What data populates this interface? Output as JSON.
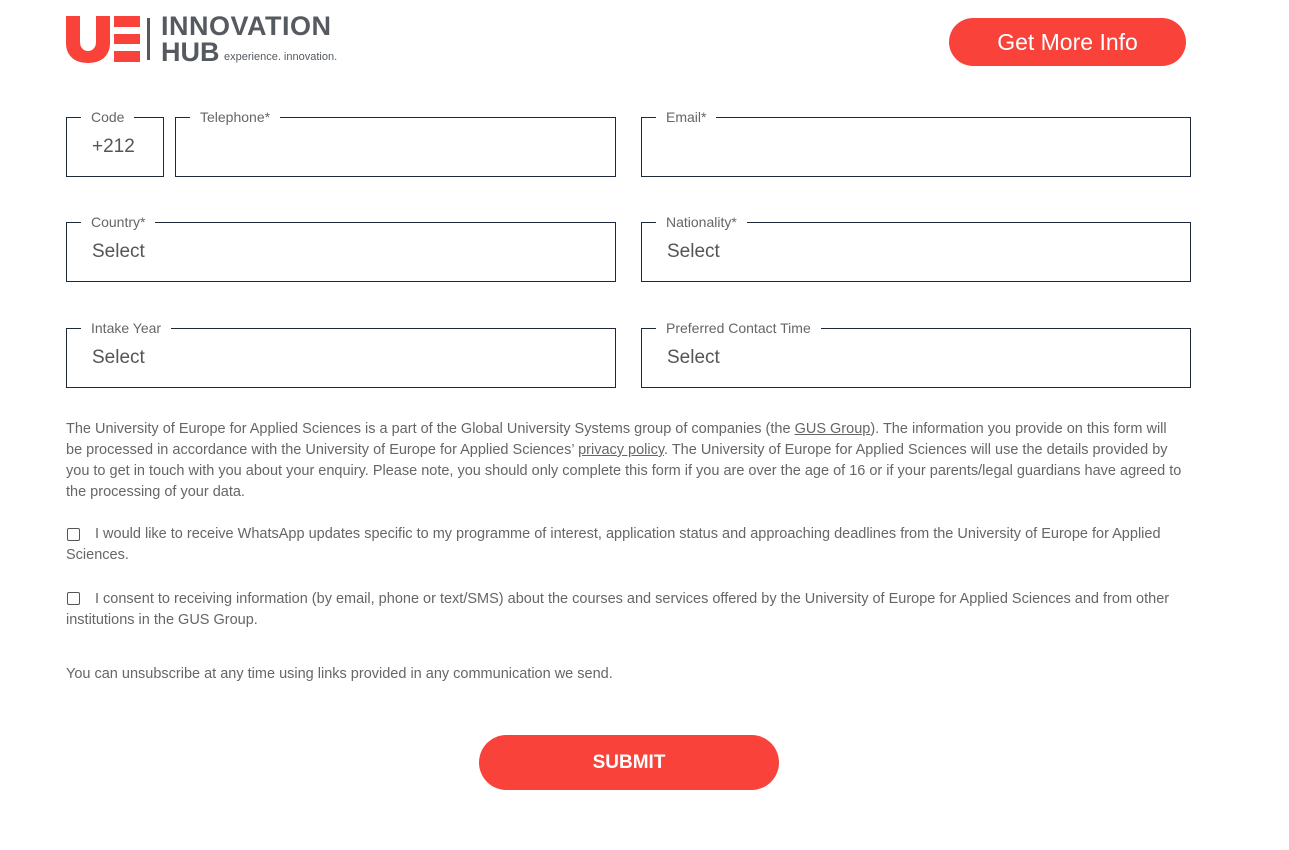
{
  "header": {
    "logo_line1": "INNOVATION",
    "logo_line2": "HUB",
    "logo_tagline": "experience. innovation.",
    "cta_label": "Get More Info"
  },
  "form": {
    "code": {
      "label": "Code",
      "value": "+212"
    },
    "telephone": {
      "label": "Telephone*",
      "value": ""
    },
    "email": {
      "label": "Email*",
      "value": ""
    },
    "country": {
      "label": "Country*",
      "value": "Select"
    },
    "nationality": {
      "label": "Nationality*",
      "value": "Select"
    },
    "intake_year": {
      "label": "Intake Year",
      "value": "Select"
    },
    "contact_time": {
      "label": "Preferred Contact Time",
      "value": "Select"
    }
  },
  "privacy": {
    "text_1": "The University of Europe for Applied Sciences is a part of the Global University Systems group of companies (the ",
    "gus_link": "GUS Group",
    "text_2": "). The information you provide on this form will be processed in accordance with the University of Europe for Applied Sciences’ ",
    "policy_link": "privacy policy",
    "text_3": ". The University of Europe for Applied Sciences will use the details provided by you to get in touch with you about your enquiry. Please note, you should only complete this form if you are over the age of 16 or if your parents/legal guardians have agreed to the processing of your data."
  },
  "consents": {
    "whatsapp": "I would like to receive WhatsApp updates specific to my programme of interest, application status and approaching deadlines from the University of Europe for Applied Sciences.",
    "info": "I consent to receiving information (by email, phone or text/SMS) about the courses and services offered by the University of Europe for Applied Sciences and from other institutions in the GUS Group."
  },
  "unsubscribe": "You can unsubscribe at any time using links provided in any communication we send.",
  "submit_label": "SUBMIT",
  "colors": {
    "accent": "#f8423a",
    "text": "#666666",
    "border": "#1e2a3a"
  }
}
